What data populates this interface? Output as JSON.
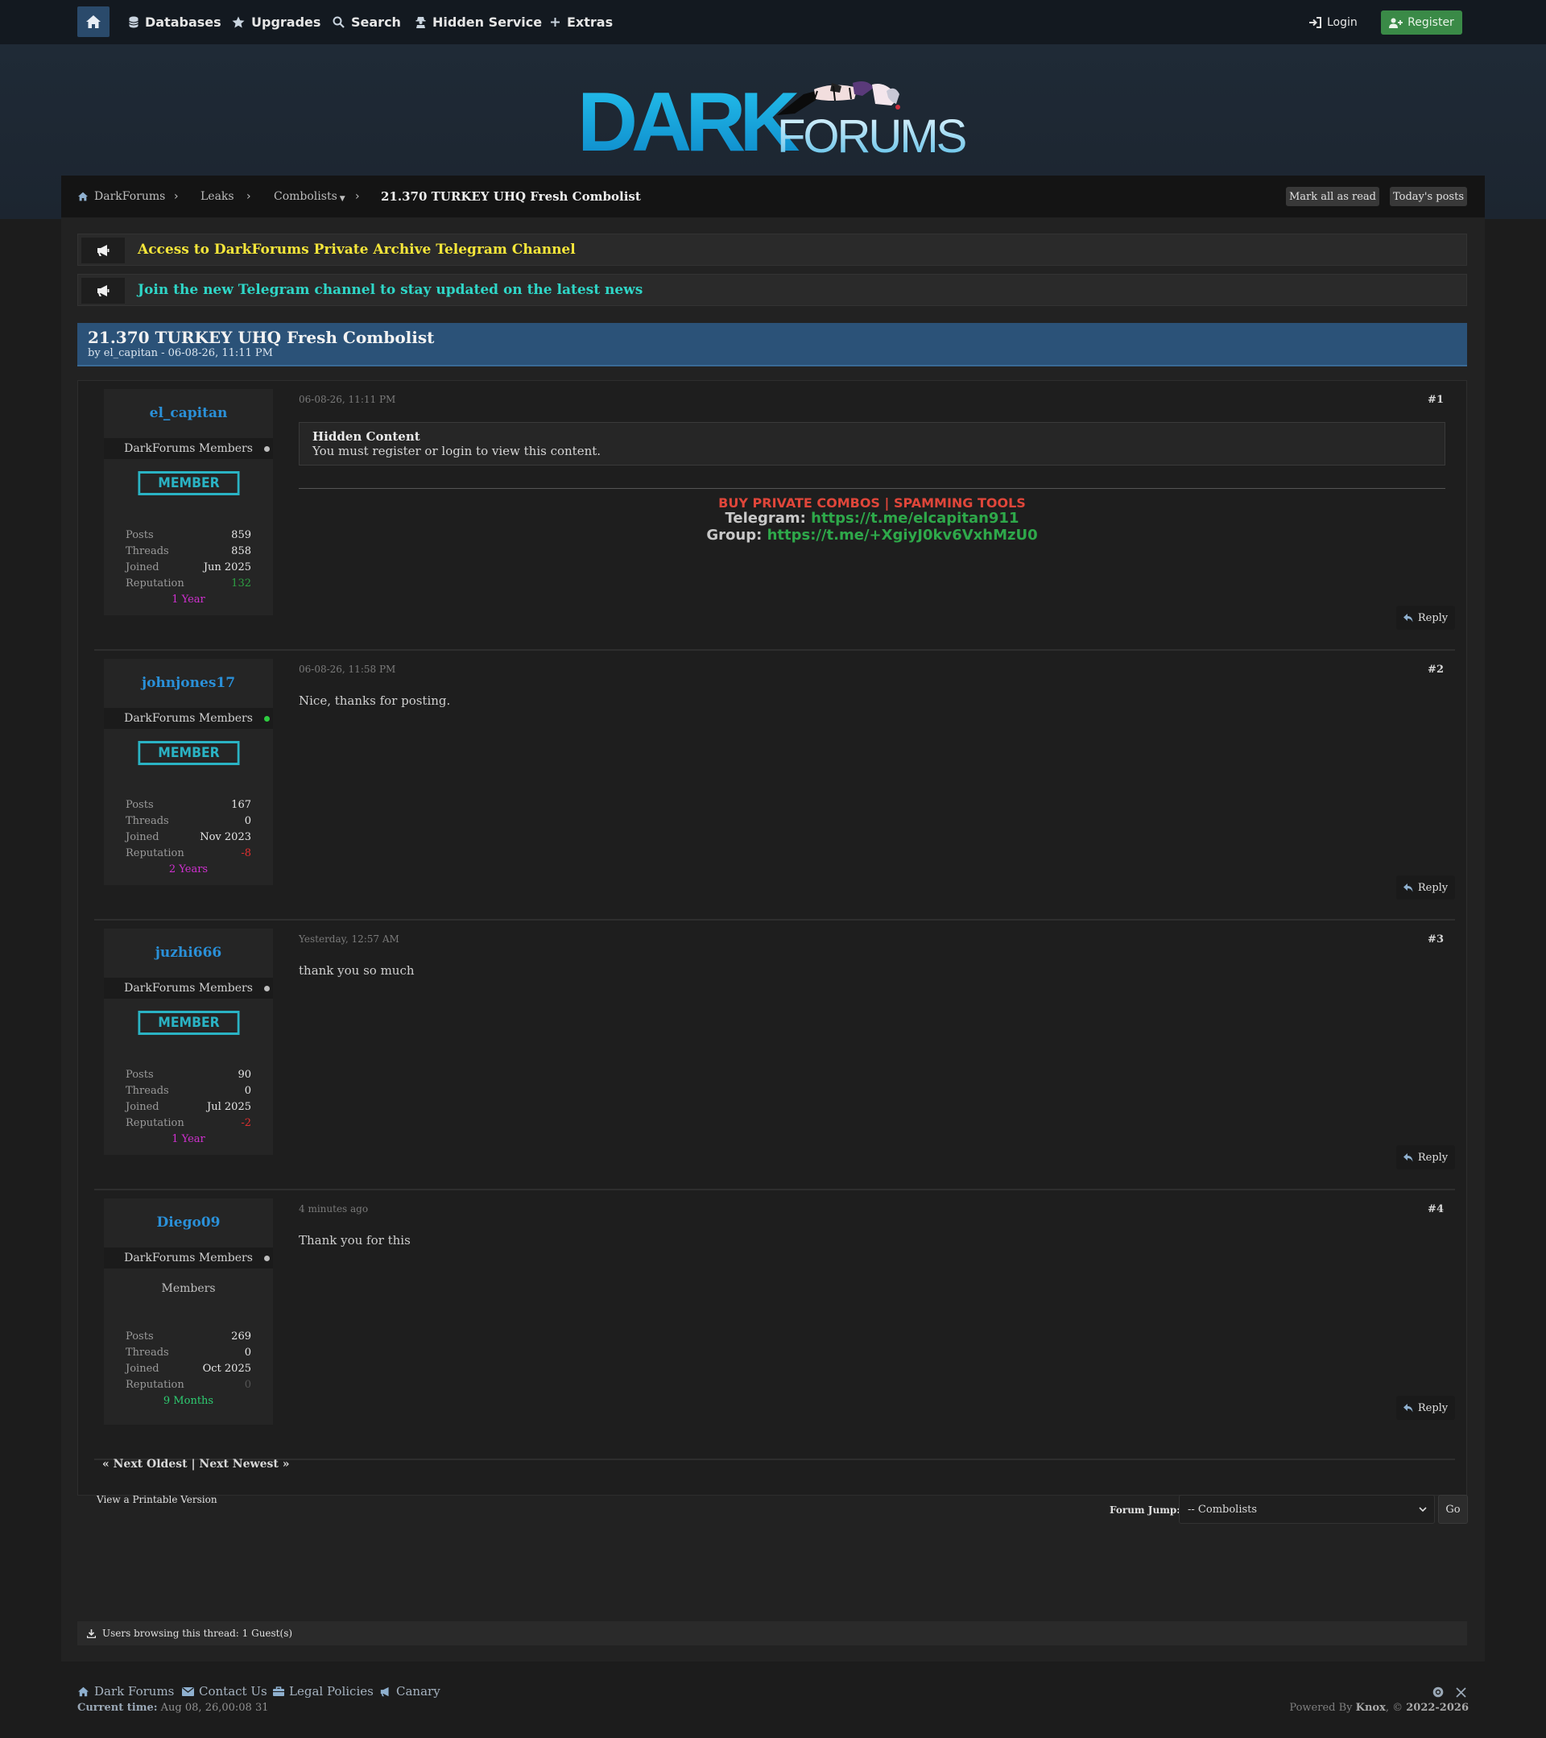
{
  "nav": {
    "items": [
      {
        "label": "Databases",
        "icon": "database-icon"
      },
      {
        "label": "Upgrades",
        "icon": "star-icon"
      },
      {
        "label": "Search",
        "icon": "search-icon"
      },
      {
        "label": "Hidden Service",
        "icon": "user-secret-icon"
      },
      {
        "label": "Extras",
        "icon": "plus-icon"
      }
    ],
    "login": "Login",
    "register": "Register"
  },
  "logo": {
    "word1": "DARK",
    "word2": "FORUMS"
  },
  "breadcrumb": {
    "items": [
      "DarkForums",
      "Leaks",
      "Combolists"
    ],
    "current": "21.370 TURKEY UHQ Fresh Combolist",
    "mark_read": "Mark all as read",
    "todays_posts": "Today's posts"
  },
  "announcements": [
    {
      "text": "Access to DarkForums Private Archive Telegram Channel",
      "color": "#f5e63a"
    },
    {
      "text": "Join the new Telegram channel to stay updated on the latest news",
      "color": "#2fd6c7"
    }
  ],
  "thread": {
    "title": "21.370 TURKEY UHQ Fresh Combolist",
    "byline": "by el_capitan - 06-08-26, 11:11 PM"
  },
  "posts": [
    {
      "username": "el_capitan",
      "group": "DarkForums Members",
      "online": false,
      "badge": "MEMBER",
      "stats": {
        "posts": "859",
        "threads": "858",
        "joined": "Jun 2025",
        "reputation": "132"
      },
      "reputation_color": "#2ea043",
      "tenure": "1 Year",
      "tenure_color": "#d030d0",
      "date": "06-08-26, 11:11 PM",
      "number": "#1",
      "hidden_title": "Hidden Content",
      "hidden_msg": "You must register or login to view this content.",
      "promo_line1": "BUY PRIVATE COMBOS | SPAMMING TOOLS",
      "promo_tg_label": "Telegram:",
      "promo_tg_link": "https://t.me/elcapitan911",
      "promo_group_label": "Group:",
      "promo_group_link": "https://t.me/+XgiyJ0kv6VxhMzU0"
    },
    {
      "username": "johnjones17",
      "group": "DarkForums Members",
      "online": true,
      "badge": "MEMBER",
      "stats": {
        "posts": "167",
        "threads": "0",
        "joined": "Nov 2023",
        "reputation": "-8"
      },
      "reputation_color": "#e03030",
      "tenure": "2 Years",
      "tenure_color": "#d030d0",
      "date": "06-08-26, 11:58 PM",
      "number": "#2",
      "message": "Nice, thanks for posting."
    },
    {
      "username": "juzhi666",
      "group": "DarkForums Members",
      "online": false,
      "badge": "MEMBER",
      "stats": {
        "posts": "90",
        "threads": "0",
        "joined": "Jul 2025",
        "reputation": "-2"
      },
      "reputation_color": "#e03030",
      "tenure": "1 Year",
      "tenure_color": "#d030d0",
      "date": "Yesterday, 12:57 AM",
      "number": "#3",
      "message": "thank you so much"
    },
    {
      "username": "Diego09",
      "group": "DarkForums Members",
      "online": false,
      "group_text": "Members",
      "stats": {
        "posts": "269",
        "threads": "0",
        "joined": "Oct 2025",
        "reputation": "0"
      },
      "reputation_color": "#555555",
      "tenure": "9 Months",
      "tenure_color": "#2ecc71",
      "date": "4 minutes ago",
      "number": "#4",
      "message": "Thank you for this"
    }
  ],
  "labels": {
    "posts": "Posts",
    "threads": "Threads",
    "joined": "Joined",
    "reputation": "Reputation",
    "reply": "Reply"
  },
  "pager": "« Next Oldest | Next Newest »",
  "printable": "View a Printable Version",
  "forum_jump": {
    "label": "Forum Jump:",
    "selected": "-- Combolists",
    "go": "Go"
  },
  "browsing": "Users browsing this thread: 1 Guest(s)",
  "footer": {
    "links": [
      {
        "label": "Dark Forums",
        "icon": "home-icon"
      },
      {
        "label": "Contact Us",
        "icon": "envelope-icon"
      },
      {
        "label": "Legal Policies",
        "icon": "briefcase-icon"
      },
      {
        "label": "Canary",
        "icon": "bullhorn-icon"
      }
    ],
    "time_label": "Current time:",
    "time_value": "Aug 08, 26,00:08 31",
    "powered_prefix": "Powered By",
    "powered_name": "Knox",
    "copyright": ", © ",
    "years": "2022-2026"
  }
}
